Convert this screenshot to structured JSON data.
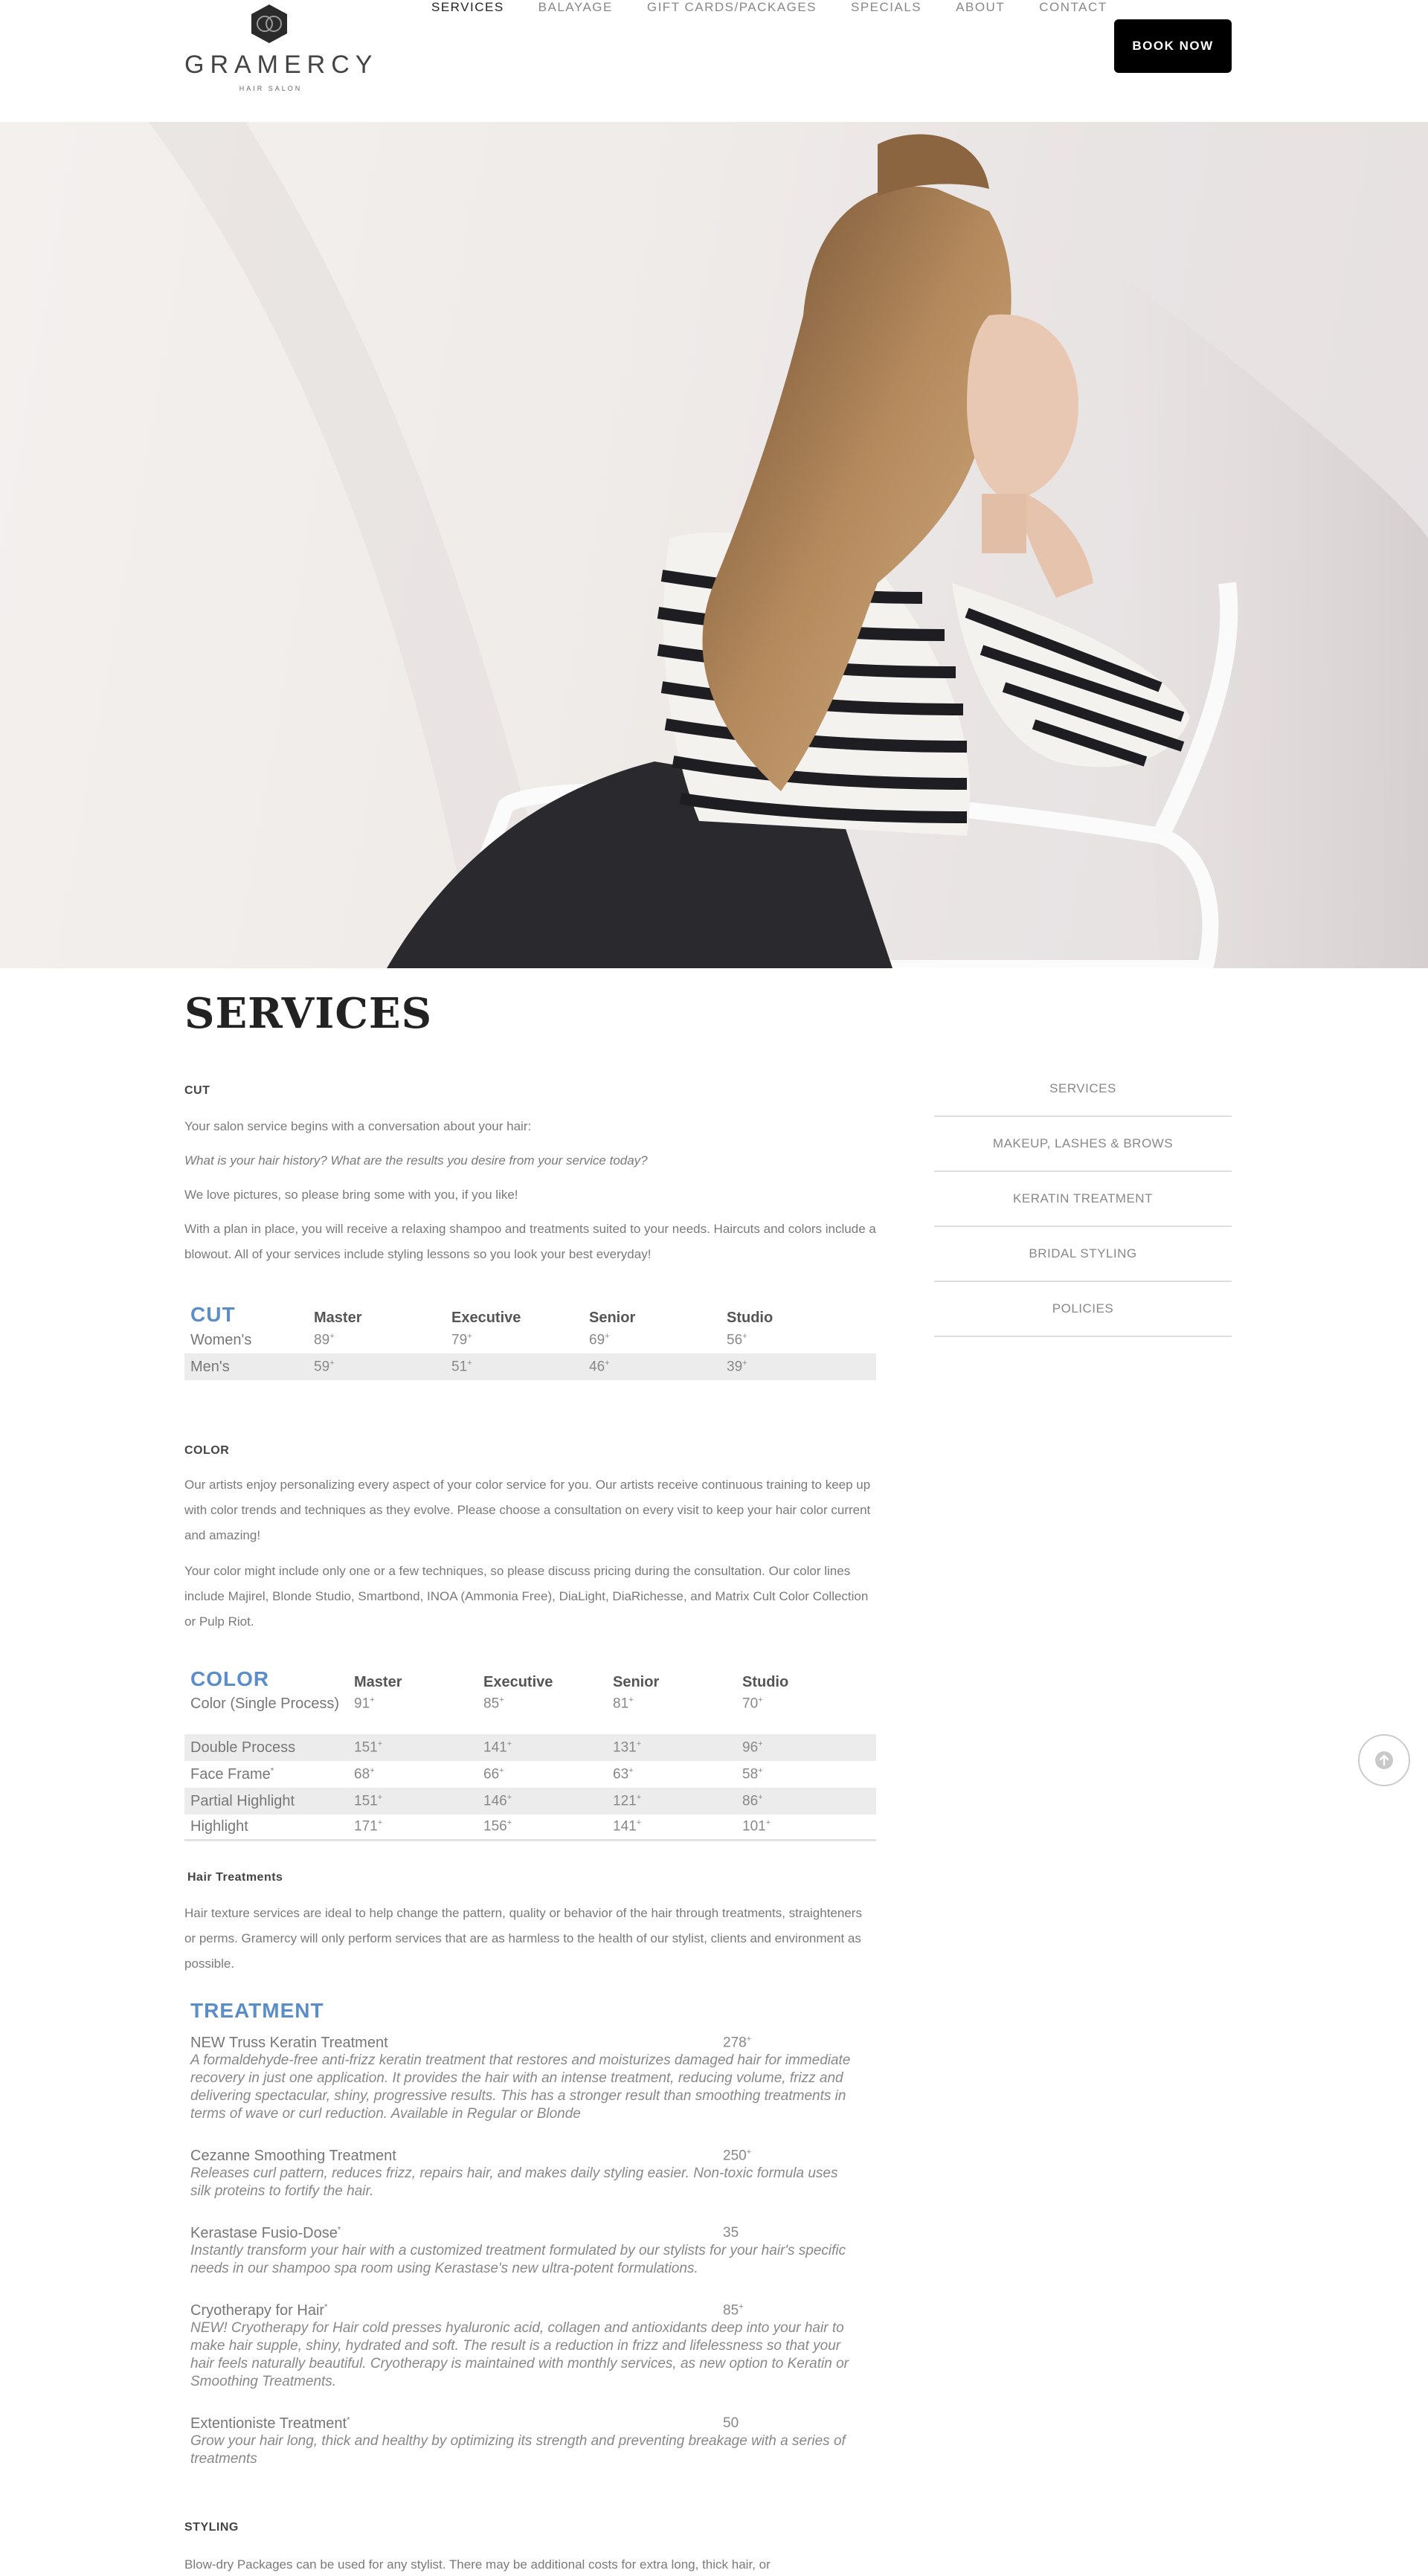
{
  "header": {
    "logo_word": "GRAMERCY",
    "logo_sub": "HAIR SALON",
    "nav": [
      "SERVICES",
      "BALAYAGE",
      "GIFT CARDS/PACKAGES",
      "SPECIALS",
      "ABOUT",
      "CONTACT"
    ],
    "book_label": "BOOK NOW"
  },
  "page_title": "SERVICES",
  "cut": {
    "heading": "CUT",
    "p1": "Your salon service begins with a conversation about your hair:",
    "p2": "What is your hair history? What are the results you desire from your service today?",
    "p3": "We love pictures, so please bring some with you, if you like!",
    "p4": "With a plan in place, you will receive a relaxing shampoo and treatments suited to your needs. Haircuts and colors include a blowout. All of your services include styling lessons so you look your best everyday!",
    "table": {
      "title": "CUT",
      "cols": [
        "Master",
        "Executive",
        "Senior",
        "Studio"
      ],
      "rows": [
        {
          "label": "Women's",
          "vals": [
            "89",
            "79",
            "69",
            "56"
          ]
        },
        {
          "label": "Men's",
          "vals": [
            "59",
            "51",
            "46",
            "39"
          ]
        }
      ]
    }
  },
  "color": {
    "heading": "COLOR",
    "p1": "Our artists enjoy personalizing every aspect of your color service for you. Our artists receive continuous training to keep up with color trends and techniques as they evolve. Please choose a consultation on every visit to keep your hair color current and amazing!",
    "p2": "Your color might include only one or a few techniques, so please discuss pricing during the consultation. Our color lines include Majirel, Blonde Studio, Smartbond, INOA (Ammonia Free), DiaLight, DiaRichesse, and Matrix Cult Color Collection or Pulp Riot.",
    "table": {
      "title": "COLOR",
      "cols": [
        "Master",
        "Executive",
        "Senior",
        "Studio"
      ],
      "rows": [
        {
          "label": "Color (Single Process)",
          "vals": [
            "91",
            "85",
            "81",
            "70"
          ]
        },
        {
          "label": "Double Process",
          "vals": [
            "151",
            "141",
            "131",
            "96"
          ]
        },
        {
          "label": "Face Frame",
          "vals": [
            "68",
            "66",
            "63",
            "58"
          ]
        },
        {
          "label": "Partial Highlight",
          "vals": [
            "151",
            "146",
            "121",
            "86"
          ]
        },
        {
          "label": "Highlight",
          "vals": [
            "171",
            "156",
            "141",
            "101"
          ]
        }
      ]
    }
  },
  "treatments": {
    "heading": "Hair Treatments",
    "p1": "Hair texture services are ideal to help change the pattern, quality or behavior of the hair through treatments, straighteners or perms. Gramercy will only perform services that are as harmless to the health of our stylist, clients and environment as possible.",
    "title": "TREATMENT",
    "items": [
      {
        "name": "NEW Truss Keratin Treatment",
        "price": "278",
        "desc": "A formaldehyde-free anti-frizz keratin treatment that restores and moisturizes damaged hair for immediate recovery in just one application. It provides the hair with an intense treatment, reducing volume, frizz and delivering spectacular, shiny, progressive results. This has a stronger result than smoothing treatments in terms of wave or curl reduction. Available in Regular or Blonde"
      },
      {
        "name": "Cezanne Smoothing Treatment",
        "price": "250",
        "desc": "Releases curl pattern, reduces frizz, repairs hair, and makes daily styling easier. Non-toxic formula uses silk proteins to fortify the hair."
      },
      {
        "name": "Kerastase Fusio-Dose",
        "price": "35",
        "desc": "Instantly transform your hair with a customized treatment formulated by our stylists for your hair's specific needs in our shampoo spa room using Kerastase's new ultra-potent formulations."
      },
      {
        "name": "Cryotherapy for Hair",
        "price": "85",
        "desc": "NEW! Cryotherapy for Hair cold presses hyaluronic acid, collagen and antioxidants deep into your hair to make hair supple, shiny, hydrated and soft. The result is a reduction in frizz and lifelessness so that your hair feels naturally beautiful. Cryotherapy is maintained with monthly services, as new option to Keratin or Smoothing Treatments."
      },
      {
        "name": "Extentioniste Treatment",
        "price": "50",
        "desc": "Grow your hair long, thick and healthy by optimizing its strength and preventing breakage with a series of treatments"
      }
    ]
  },
  "styling": {
    "heading": "STYLING",
    "p1": "Blow-dry Packages can be used for any stylist.  There may be additional costs for extra long, thick hair, or"
  },
  "sidebar": [
    "SERVICES",
    "MAKEUP, LASHES & BROWS",
    "KERATIN TREATMENT",
    "BRIDAL STYLING",
    "POLICIES"
  ],
  "colors": {
    "accent": "#5b8dc9",
    "button": "#000000",
    "shade": "#ececec"
  },
  "icons": {
    "scroll_top": "arrow-up-icon"
  }
}
